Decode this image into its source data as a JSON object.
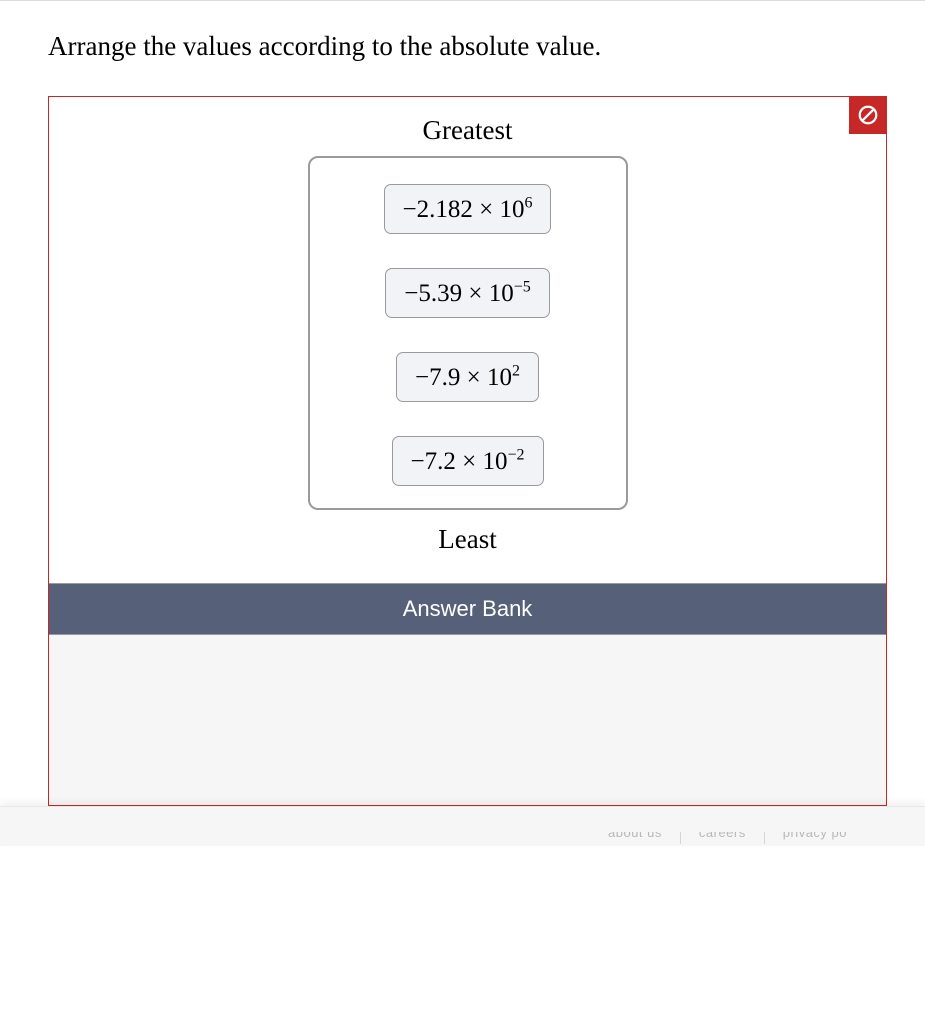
{
  "prompt": "Arrange the values according to the absolute value.",
  "labels": {
    "top": "Greatest",
    "bottom": "Least",
    "bank_header": "Answer Bank"
  },
  "status": {
    "incorrect": true,
    "icon": "incorrect-icon"
  },
  "items": [
    {
      "mantissa": "−2.182",
      "times": " × 10",
      "exp": "6"
    },
    {
      "mantissa": "−5.39",
      "times": " × 10",
      "exp": "−5"
    },
    {
      "mantissa": "−7.9",
      "times": " × 10",
      "exp": "2"
    },
    {
      "mantissa": "−7.2",
      "times": " × 10",
      "exp": "−2"
    }
  ],
  "bank_items": [],
  "footer": {
    "links": [
      "about us",
      "careers",
      "privacy po"
    ]
  }
}
